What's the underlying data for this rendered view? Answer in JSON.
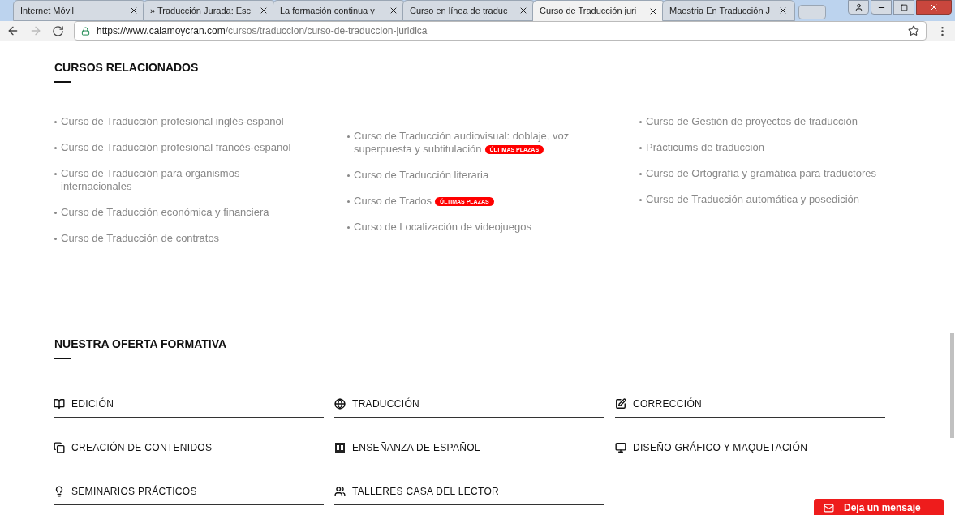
{
  "browser": {
    "tabs": [
      {
        "title": "Internet Móvil",
        "selected": false
      },
      {
        "title": "» Traducción Jurada: Esc",
        "selected": false
      },
      {
        "title": "La formación continua y",
        "selected": false
      },
      {
        "title": "Curso en línea de traduc",
        "selected": false
      },
      {
        "title": "Curso de Traducción juri",
        "selected": true
      },
      {
        "title": "Maestria En Traducción J",
        "selected": false
      }
    ],
    "url_host": "https://www.calamoycran.com",
    "url_path": "/cursos/traduccion/curso-de-traduccion-juridica"
  },
  "related": {
    "title": "CURSOS RELACIONADOS",
    "columns": [
      [
        {
          "label": "Curso de Traducción profesional inglés-español"
        },
        {
          "label": "Curso de Traducción profesional francés-español"
        },
        {
          "label": "Curso de Traducción para organismos internacionales"
        },
        {
          "label": "Curso de Traducción económica y financiera"
        },
        {
          "label": "Curso de Traducción de contratos"
        }
      ],
      [
        {
          "label": "Curso de Traducción audiovisual: doblaje, voz superpuesta y subtitulación",
          "badge": "ÚLTIMAS PLAZAS"
        },
        {
          "label": "Curso de Traducción literaria"
        },
        {
          "label": "Curso de Trados",
          "badge": "ÚLTIMAS PLAZAS"
        },
        {
          "label": "Curso de Localización de videojuegos"
        }
      ],
      [
        {
          "label": "Curso de Gestión de proyectos de traducción"
        },
        {
          "label": "Prácticums de traducción"
        },
        {
          "label": "Curso de Ortografía y gramática para traductores"
        },
        {
          "label": "Curso de Traducción automática y posedición"
        }
      ]
    ]
  },
  "offer": {
    "title": "NUESTRA OFERTA FORMATIVA",
    "items": [
      {
        "label": "EDICIÓN"
      },
      {
        "label": "TRADUCCIÓN"
      },
      {
        "label": "CORRECCIÓN"
      },
      {
        "label": "CREACIÓN DE CONTENIDOS"
      },
      {
        "label": "ENSEÑANZA DE ESPAÑOL"
      },
      {
        "label": "DISEÑO GRÁFICO Y MAQUETACIÓN"
      },
      {
        "label": "SEMINARIOS PRÁCTICOS"
      },
      {
        "label": "TALLERES CASA DEL LECTOR"
      }
    ]
  },
  "chat_button": "Deja un mensaje"
}
